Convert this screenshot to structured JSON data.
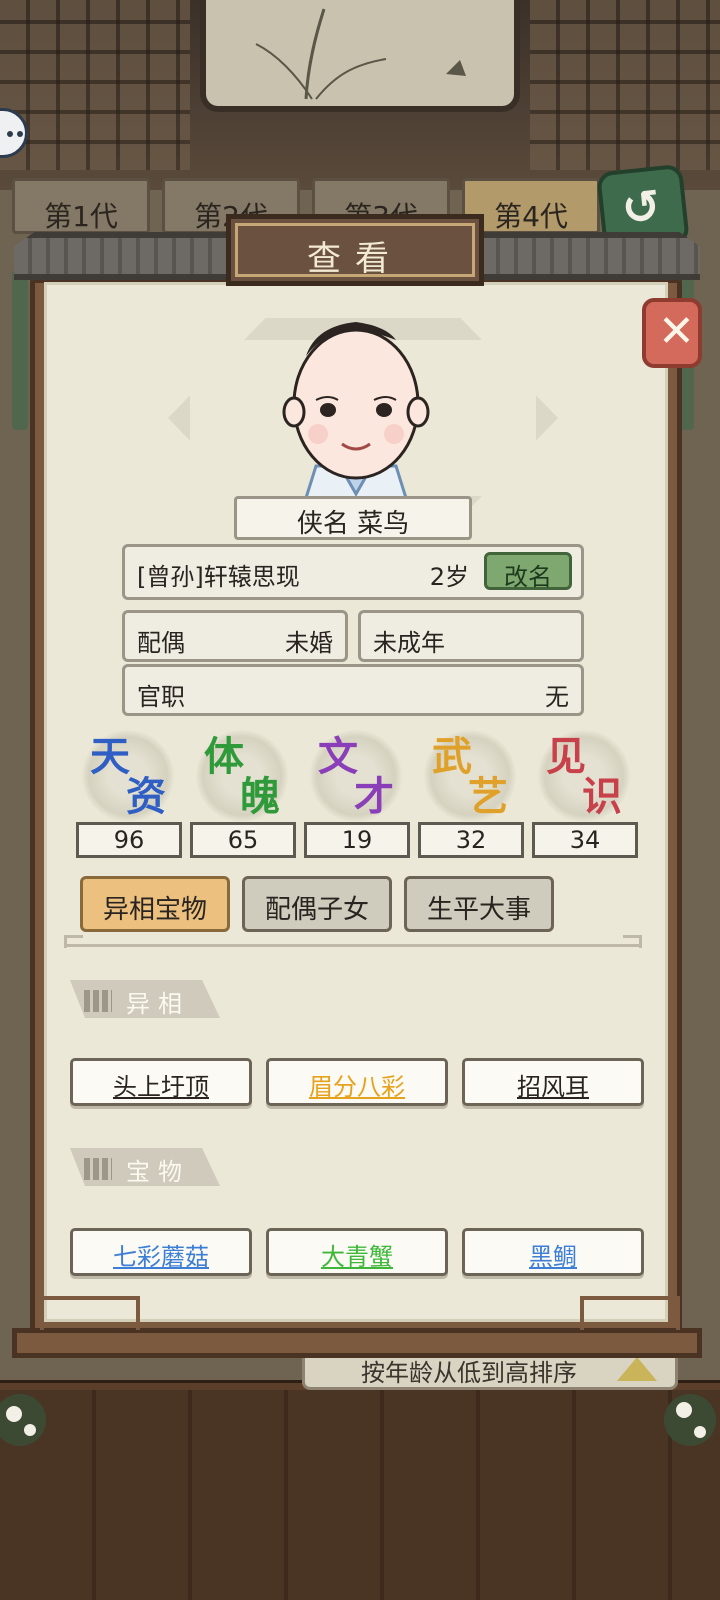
{
  "generation_tabs": [
    {
      "label": "第1代"
    },
    {
      "label": "第2代"
    },
    {
      "label": "第3代"
    },
    {
      "label": "第4代"
    }
  ],
  "sort_bar": {
    "label": "按年龄从低到高排序"
  },
  "panel": {
    "title": "查看",
    "hero_name": "侠名 菜鸟",
    "identity": {
      "title": "[曾孙]轩辕思现",
      "age": "2岁",
      "rename_label": "改名"
    },
    "spouse": {
      "label": "配偶",
      "value": "未婚"
    },
    "adult_status": "未成年",
    "office": {
      "label": "官职",
      "value": "无"
    },
    "stats": [
      {
        "c1": "天",
        "c2": "资",
        "value": "96",
        "color": "#2f5fc4"
      },
      {
        "c1": "体",
        "c2": "魄",
        "value": "65",
        "color": "#2f9a3a"
      },
      {
        "c1": "文",
        "c2": "才",
        "value": "19",
        "color": "#8a3fb8"
      },
      {
        "c1": "武",
        "c2": "艺",
        "value": "32",
        "color": "#e0a12a"
      },
      {
        "c1": "见",
        "c2": "识",
        "value": "34",
        "color": "#c8414a"
      }
    ],
    "tabs": [
      {
        "label": "异相宝物",
        "active": true
      },
      {
        "label": "配偶子女",
        "active": false
      },
      {
        "label": "生平大事",
        "active": false
      }
    ],
    "traits_section": {
      "title": "异相",
      "items": [
        {
          "label": "头上圩顶",
          "color": "#2a2420"
        },
        {
          "label": "眉分八彩",
          "color": "#e7a21d"
        },
        {
          "label": "招风耳",
          "color": "#2a2420"
        }
      ]
    },
    "treasures_section": {
      "title": "宝物",
      "items": [
        {
          "label": "七彩蘑菇",
          "color": "#3d7fd6"
        },
        {
          "label": "大青蟹",
          "color": "#3fb83a"
        },
        {
          "label": "黑鲷",
          "color": "#3d7fd6"
        }
      ]
    }
  }
}
